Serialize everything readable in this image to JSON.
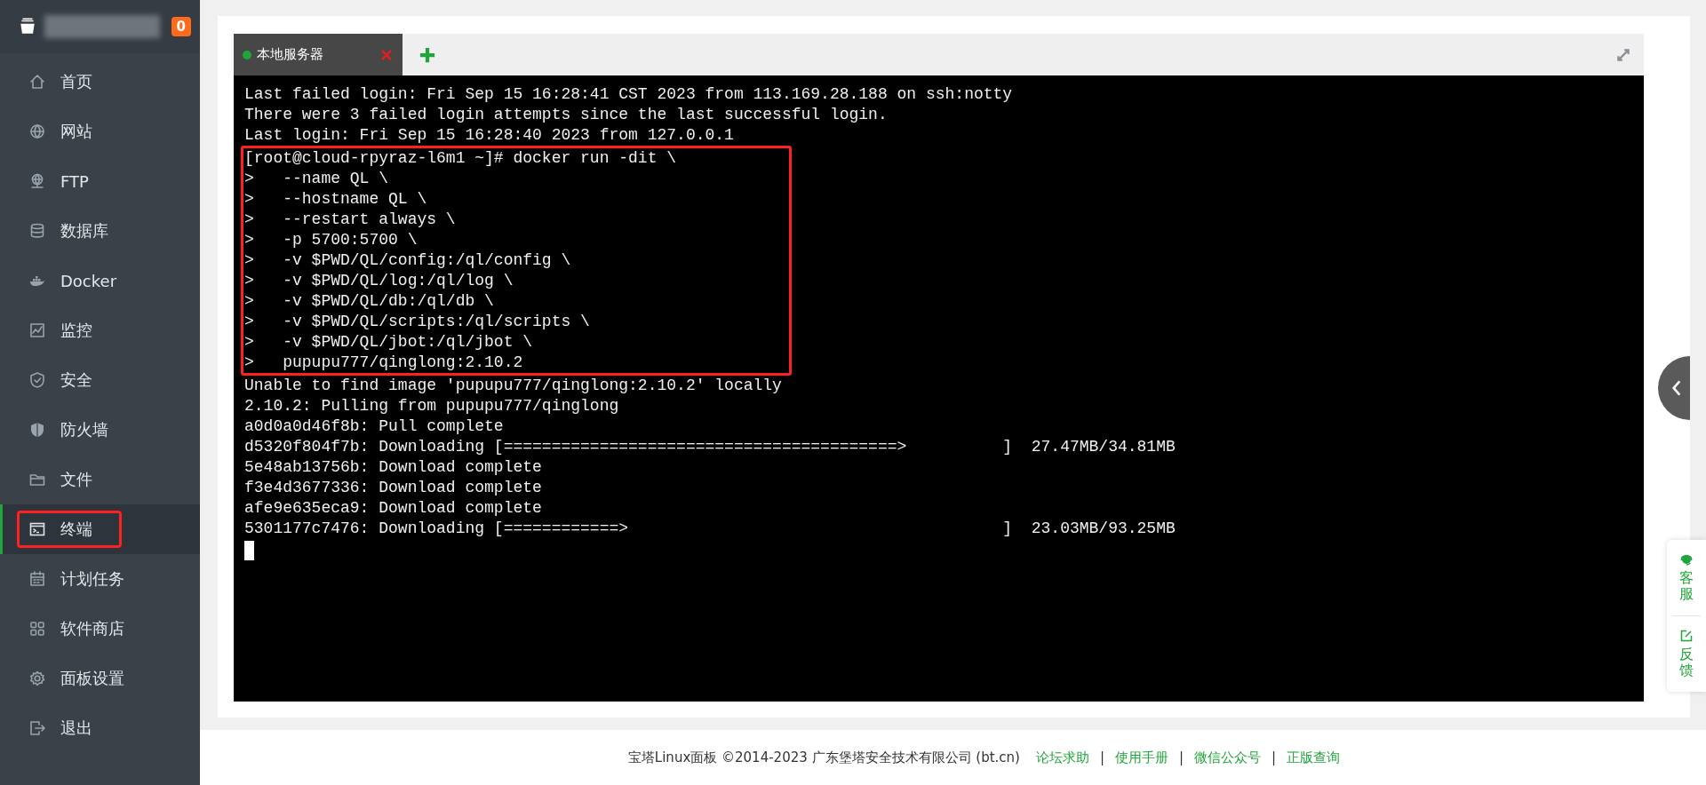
{
  "sidebar": {
    "badge": "0",
    "items": [
      {
        "label": "首页",
        "selected": false,
        "highlighted": false
      },
      {
        "label": "网站",
        "selected": false,
        "highlighted": false
      },
      {
        "label": "FTP",
        "selected": false,
        "highlighted": false
      },
      {
        "label": "数据库",
        "selected": false,
        "highlighted": false
      },
      {
        "label": "Docker",
        "selected": false,
        "highlighted": false
      },
      {
        "label": "监控",
        "selected": false,
        "highlighted": false
      },
      {
        "label": "安全",
        "selected": false,
        "highlighted": false
      },
      {
        "label": "防火墙",
        "selected": false,
        "highlighted": false
      },
      {
        "label": "文件",
        "selected": false,
        "highlighted": false
      },
      {
        "label": "终端",
        "selected": true,
        "highlighted": true
      },
      {
        "label": "计划任务",
        "selected": false,
        "highlighted": false
      },
      {
        "label": "软件商店",
        "selected": false,
        "highlighted": false
      },
      {
        "label": "面板设置",
        "selected": false,
        "highlighted": false
      },
      {
        "label": "退出",
        "selected": false,
        "highlighted": false
      }
    ]
  },
  "tabs": [
    {
      "label": "本地服务器",
      "selected": true,
      "connected": true
    }
  ],
  "terminal": {
    "cursor": true,
    "lines": [
      "Last failed login: Fri Sep 15 16:28:41 CST 2023 from 113.169.28.188 on ssh:notty",
      "There were 3 failed login attempts since the last successful login.",
      "Last login: Fri Sep 15 16:28:40 2023 from 127.0.0.1"
    ],
    "command": {
      "highlighted": true,
      "lines": [
        "[root@cloud-rpyraz-l6m1 ~]# docker run -dit \\",
        ">   --name QL \\",
        ">   --hostname QL \\",
        ">   --restart always \\",
        ">   -p 5700:5700 \\",
        ">   -v $PWD/QL/config:/ql/config \\",
        ">   -v $PWD/QL/log:/ql/log \\",
        ">   -v $PWD/QL/db:/ql/db \\",
        ">   -v $PWD/QL/scripts:/ql/scripts \\",
        ">   -v $PWD/QL/jbot:/ql/jbot \\",
        ">   pupupu777/qinglong:2.10.2"
      ]
    },
    "output": [
      "Unable to find image 'pupupu777/qinglong:2.10.2' locally",
      "2.10.2: Pulling from pupupu777/qinglong",
      "a0d0a0d46f8b: Pull complete",
      "d5320f804f7b: Downloading [=========================================>          ]  27.47MB/34.81MB",
      "5e48ab13756b: Download complete",
      "f3e4d3677336: Download complete",
      "afe9e635eca9: Download complete",
      "5301177c7476: Downloading [============>                                       ]  23.03MB/93.25MB"
    ]
  },
  "side_tools": [
    {
      "label": "客服"
    },
    {
      "label": "反馈"
    }
  ],
  "footer": {
    "copyright": "宝塔Linux面板 ©2014-2023 广东堡塔安全技术有限公司 (bt.cn)",
    "items": [
      {
        "kind": "link",
        "text": "论坛求助"
      },
      {
        "kind": "separator",
        "text": "|"
      },
      {
        "kind": "link",
        "text": "使用手册"
      },
      {
        "kind": "separator",
        "text": "|"
      },
      {
        "kind": "link",
        "text": "微信公众号"
      },
      {
        "kind": "separator",
        "text": "|"
      },
      {
        "kind": "link",
        "text": "正版查询"
      }
    ]
  }
}
